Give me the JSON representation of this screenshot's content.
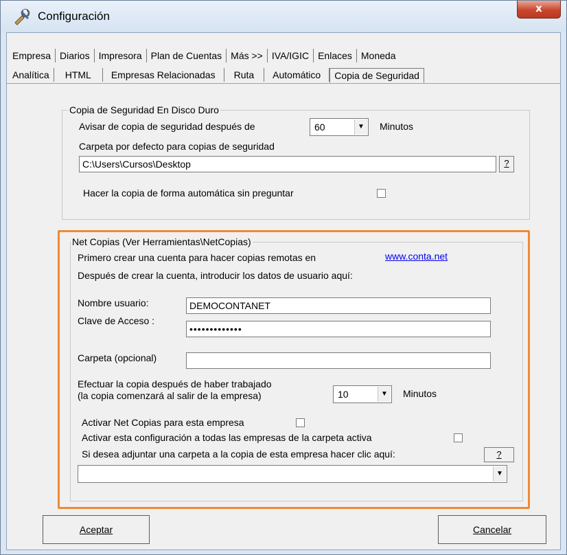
{
  "window": {
    "title": "Configuración",
    "close_label": "x"
  },
  "tabs": {
    "row1": [
      {
        "label": "Empresa"
      },
      {
        "label": "Diarios"
      },
      {
        "label": "Impresora"
      },
      {
        "label": "Plan de Cuentas"
      },
      {
        "label": "Más >>"
      },
      {
        "label": "IVA/IGIC"
      },
      {
        "label": "Enlaces"
      },
      {
        "label": "Moneda"
      }
    ],
    "row2": [
      {
        "label": "Analítica"
      },
      {
        "label": "HTML"
      },
      {
        "label": "Empresas Relacionadas"
      },
      {
        "label": "Ruta"
      },
      {
        "label": "Automático"
      },
      {
        "label": "Copia de Seguridad"
      }
    ],
    "active": "Copia de Seguridad"
  },
  "disk_group": {
    "legend": "Copia de Seguridad En Disco Duro",
    "notice_label": "Avisar de copia de seguridad después de",
    "notice_value": "60",
    "notice_unit": "Minutos",
    "folder_label": "Carpeta por defecto para copias de seguridad",
    "folder_value": "C:\\Users\\Cursos\\Desktop",
    "browse_label": "?",
    "auto_label": "Hacer la copia de forma automática sin preguntar",
    "auto_checked": false
  },
  "net_group": {
    "legend": "Net Copias (Ver Herramientas\\NetCopias)",
    "intro1": "Primero crear una cuenta para hacer copias remotas en",
    "link": "www.conta.net",
    "intro2": "Después de crear la cuenta, introducir los datos de usuario aquí:",
    "user_label": "Nombre usuario:",
    "user_value": "DEMOCONTANET",
    "password_label": "Clave de Acceso :",
    "password_value": "•••••••••••••",
    "folder_label": "Carpeta (opcional)",
    "folder_value": "",
    "after_label1": "Efectuar la copia después de haber trabajado",
    "after_label2": "(la copia comenzará al salir de la empresa)",
    "after_value": "10",
    "after_unit": "Minutos",
    "activate_label": "Activar Net Copias para esta empresa",
    "activate_checked": false,
    "activate_all_label": "Activar esta configuración a todas las empresas de la carpeta activa",
    "activate_all_checked": false,
    "attach_label": "Si desea adjuntar una carpeta a la copia de esta empresa hacer clic aquí:",
    "attach_button": "?",
    "attach_value": ""
  },
  "buttons": {
    "accept": "Aceptar",
    "cancel": "Cancelar"
  },
  "colors": {
    "highlight": "#f08a34",
    "link": "#0000ee"
  }
}
